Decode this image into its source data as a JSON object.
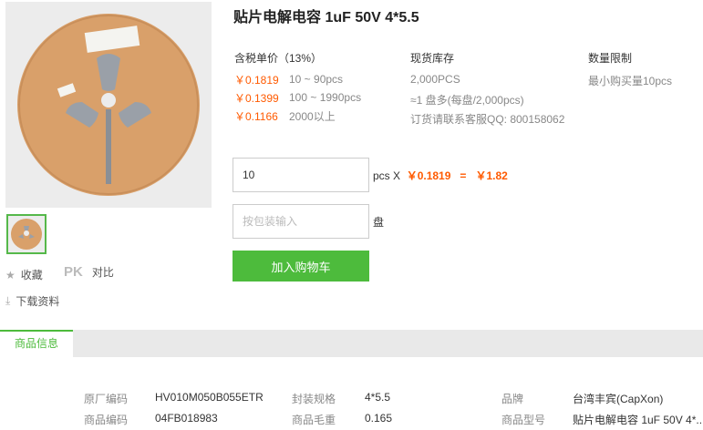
{
  "product": {
    "title": "贴片电解电容 1uF 50V 4*5.5"
  },
  "side": {
    "favorite_label": "收藏",
    "pk_label": "PK",
    "compare_label": "对比",
    "download_label": "下载资料"
  },
  "pricing": {
    "header": "含税单价（13%）",
    "tiers": [
      {
        "price": "￥0.1819",
        "range": "10 ~ 90pcs"
      },
      {
        "price": "￥0.1399",
        "range": "100 ~ 1990pcs"
      },
      {
        "price": "￥0.1166",
        "range": "2000以上"
      }
    ]
  },
  "stock": {
    "header": "现货库存",
    "qty": "2,000PCS",
    "reel": "≈1 盘多(每盘/2,000pcs)",
    "contact": "订货请联系客服QQ: 800158062"
  },
  "limit": {
    "header": "数量限制",
    "min": "最小购买量10pcs"
  },
  "order": {
    "qty_value": "10",
    "calc_unit": "pcs X",
    "calc_price": "￥0.1819",
    "calc_eq": "=",
    "calc_total": "￥1.82",
    "pack_placeholder": "按包装输入",
    "pack_unit": "盘",
    "cart_button": "加入购物车"
  },
  "tabs": {
    "active": "商品信息"
  },
  "specs": {
    "rows": [
      [
        {
          "key": "原厂编码",
          "value": "HV010M050B055ETR"
        },
        {
          "key": "封装规格",
          "value": "4*5.5"
        },
        {
          "key": "品牌",
          "value": "台湾丰宾(CapXon)"
        }
      ],
      [
        {
          "key": "商品编码",
          "value": "04FB018983"
        },
        {
          "key": "商品毛重",
          "value": "0.165"
        },
        {
          "key": "商品型号",
          "value": "贴片电解电容 1uF 50V 4*.."
        }
      ]
    ]
  }
}
